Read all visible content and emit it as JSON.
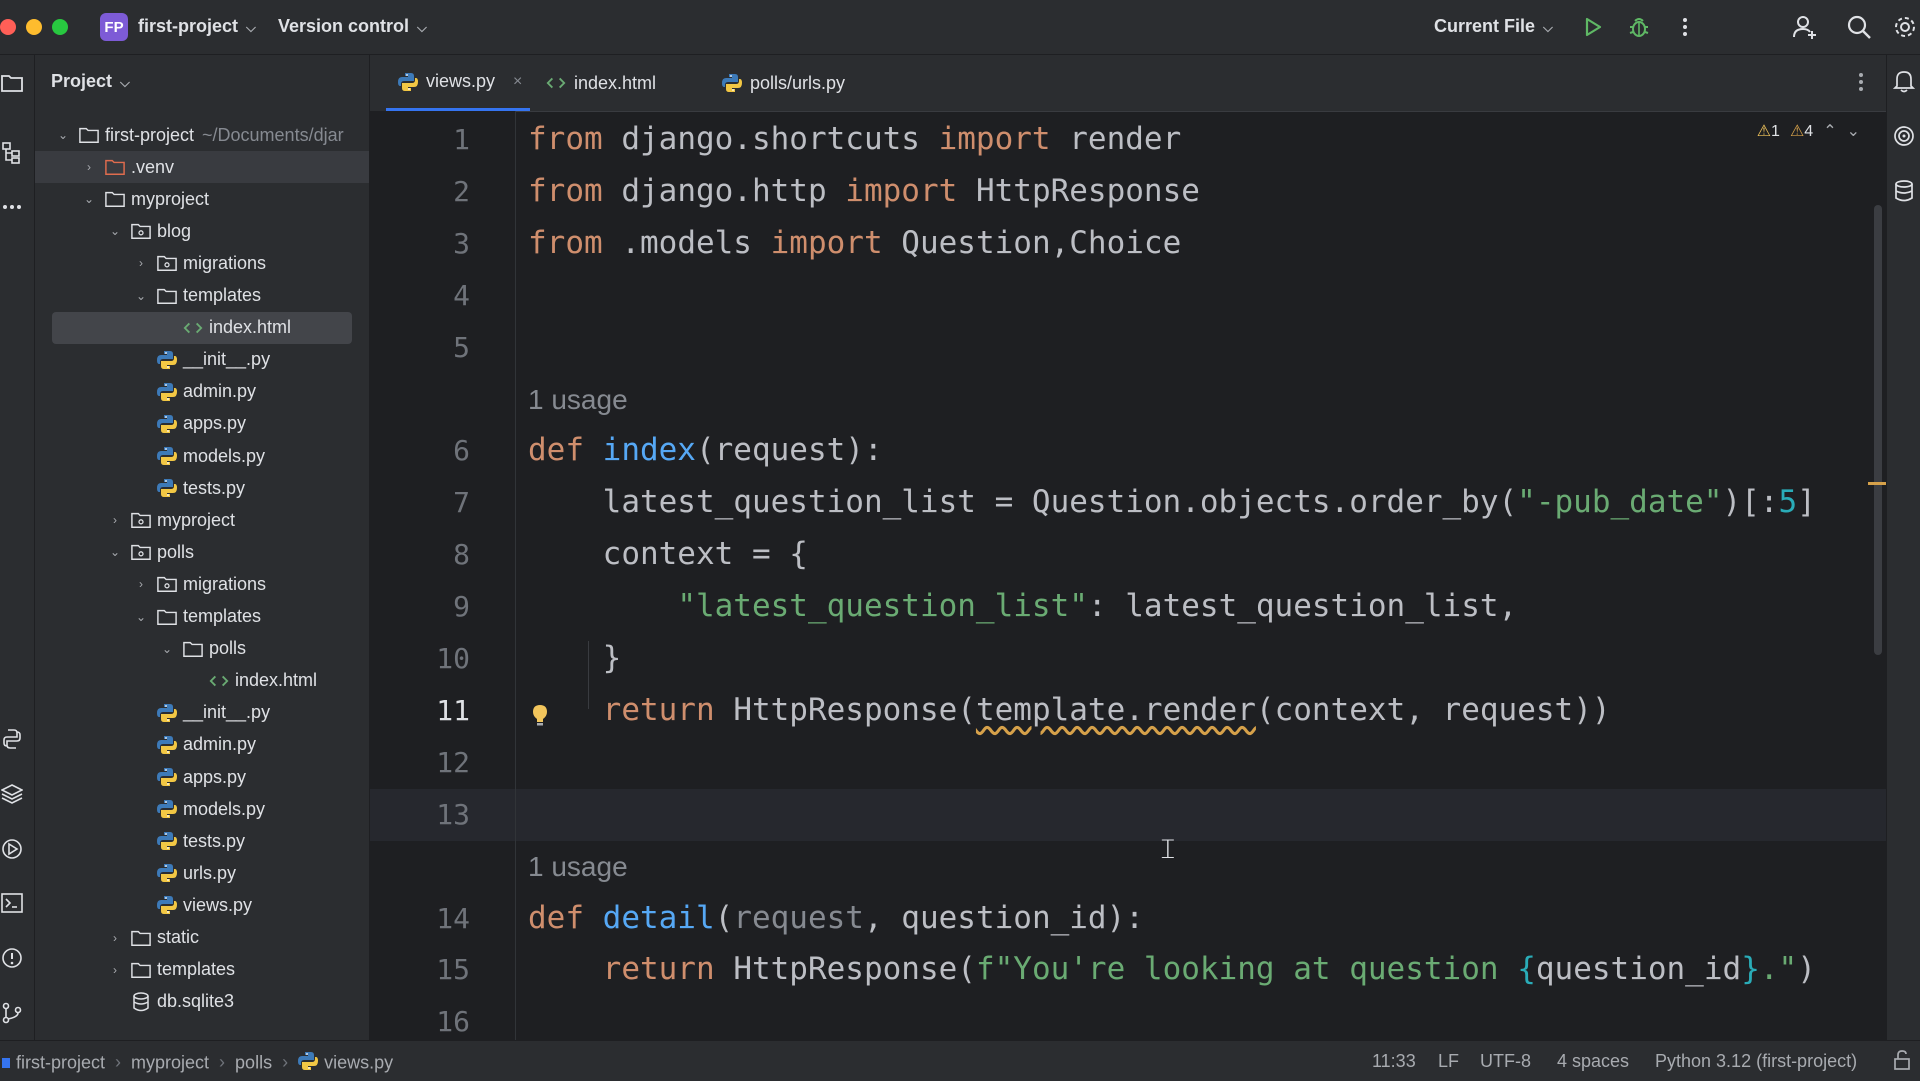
{
  "titlebar": {
    "project_badge": "FP",
    "project_name": "first-project",
    "vcs_label": "Version control",
    "run_config": "Current File",
    "icons": [
      "run-icon",
      "debug-icon",
      "more-icon",
      "add-user-icon",
      "search-icon",
      "settings-icon"
    ]
  },
  "panel": {
    "title": "Project",
    "tree": [
      {
        "label": "first-project",
        "hint": "~/Documents/djar",
        "type": "folder",
        "depth": 0,
        "expanded": true
      },
      {
        "label": ".venv",
        "type": "folder-venv",
        "depth": 1,
        "expanded": false,
        "selected": true
      },
      {
        "label": "myproject",
        "type": "folder",
        "depth": 1,
        "expanded": true
      },
      {
        "label": "blog",
        "type": "package",
        "depth": 2,
        "expanded": true
      },
      {
        "label": "migrations",
        "type": "package",
        "depth": 3,
        "expanded": false
      },
      {
        "label": "templates",
        "type": "folder",
        "depth": 3,
        "expanded": true
      },
      {
        "label": "index.html",
        "type": "html",
        "depth": 4,
        "highlight": true
      },
      {
        "label": "__init__.py",
        "type": "py",
        "depth": 3
      },
      {
        "label": "admin.py",
        "type": "py",
        "depth": 3
      },
      {
        "label": "apps.py",
        "type": "py",
        "depth": 3
      },
      {
        "label": "models.py",
        "type": "py",
        "depth": 3
      },
      {
        "label": "tests.py",
        "type": "py",
        "depth": 3
      },
      {
        "label": "myproject",
        "type": "package",
        "depth": 2,
        "expanded": false
      },
      {
        "label": "polls",
        "type": "package",
        "depth": 2,
        "expanded": true
      },
      {
        "label": "migrations",
        "type": "package",
        "depth": 3,
        "expanded": false
      },
      {
        "label": "templates",
        "type": "folder",
        "depth": 3,
        "expanded": true
      },
      {
        "label": "polls",
        "type": "folder",
        "depth": 4,
        "expanded": true
      },
      {
        "label": "index.html",
        "type": "html",
        "depth": 5
      },
      {
        "label": "__init__.py",
        "type": "py",
        "depth": 3
      },
      {
        "label": "admin.py",
        "type": "py",
        "depth": 3
      },
      {
        "label": "apps.py",
        "type": "py",
        "depth": 3
      },
      {
        "label": "models.py",
        "type": "py",
        "depth": 3
      },
      {
        "label": "tests.py",
        "type": "py",
        "depth": 3
      },
      {
        "label": "urls.py",
        "type": "py",
        "depth": 3
      },
      {
        "label": "views.py",
        "type": "py",
        "depth": 3
      },
      {
        "label": "static",
        "type": "folder",
        "depth": 2,
        "expanded": false
      },
      {
        "label": "templates",
        "type": "folder",
        "depth": 2,
        "expanded": false
      },
      {
        "label": "db.sqlite3",
        "type": "db",
        "depth": 2
      }
    ]
  },
  "tabs": [
    {
      "label": "views.py",
      "type": "py",
      "active": true,
      "close": "×"
    },
    {
      "label": "index.html",
      "type": "html",
      "active": false
    },
    {
      "label": "polls/urls.py",
      "type": "py",
      "active": false
    }
  ],
  "inspections": {
    "errors": "1",
    "warnings": "4"
  },
  "code": {
    "line_numbers": [
      "1",
      "2",
      "3",
      "4",
      "5",
      "",
      "6",
      "7",
      "8",
      "9",
      "10",
      "11",
      "12",
      "13",
      "",
      "14",
      "15",
      "16"
    ],
    "current_line": "11",
    "lines": [
      [
        [
          "kw",
          "from "
        ],
        [
          "",
          "django.shortcuts "
        ],
        [
          "kw",
          "import "
        ],
        [
          "",
          "render"
        ]
      ],
      [
        [
          "kw",
          "from "
        ],
        [
          "",
          "django.http "
        ],
        [
          "kw",
          "import "
        ],
        [
          "",
          "HttpResponse"
        ]
      ],
      [
        [
          "kw",
          "from "
        ],
        [
          "",
          ".models "
        ],
        [
          "kw",
          "import "
        ],
        [
          "",
          "Question,Choice"
        ]
      ],
      [],
      [],
      [
        [
          "usage",
          "1 usage"
        ]
      ],
      [
        [
          "kw",
          "def "
        ],
        [
          "fn",
          "index"
        ],
        [
          "",
          "(request):"
        ]
      ],
      [
        [
          "",
          "    latest_question_list = Question.objects.order_by("
        ],
        [
          "str",
          "\"-pub_date\""
        ],
        [
          "",
          ")[:"
        ],
        [
          "num",
          "5"
        ],
        [
          "",
          "]"
        ]
      ],
      [
        [
          "",
          "    context = {"
        ]
      ],
      [
        [
          "",
          "        "
        ],
        [
          "str",
          "\"latest_question_list\""
        ],
        [
          "",
          ": latest_question_list,"
        ]
      ],
      [
        [
          "",
          "    }"
        ]
      ],
      [
        [
          "",
          "    "
        ],
        [
          "kw",
          "return "
        ],
        [
          "",
          "HttpResponse("
        ],
        [
          "squig",
          "template.render"
        ],
        [
          "",
          "(context, request))"
        ]
      ],
      [],
      [],
      [
        [
          "usage",
          "1 usage"
        ]
      ],
      [
        [
          "kw",
          "def "
        ],
        [
          "fn",
          "detail"
        ],
        [
          "",
          "("
        ],
        [
          "param",
          "request"
        ],
        [
          "",
          ", question_id):"
        ]
      ],
      [
        [
          "",
          "    "
        ],
        [
          "kw",
          "return "
        ],
        [
          "",
          "HttpResponse("
        ],
        [
          "str",
          "f\"You're looking at question "
        ],
        [
          "num",
          "{"
        ],
        [
          "",
          "question_id"
        ],
        [
          "num",
          "}"
        ],
        [
          "str",
          ".\""
        ],
        [
          "",
          ")"
        ]
      ],
      []
    ]
  },
  "statusbar": {
    "breadcrumbs": [
      "first-project",
      "myproject",
      "polls",
      "views.py"
    ],
    "position": "11:33",
    "line_sep": "LF",
    "encoding": "UTF-8",
    "indent": "4 spaces",
    "interpreter": "Python 3.12 (first-project)"
  }
}
